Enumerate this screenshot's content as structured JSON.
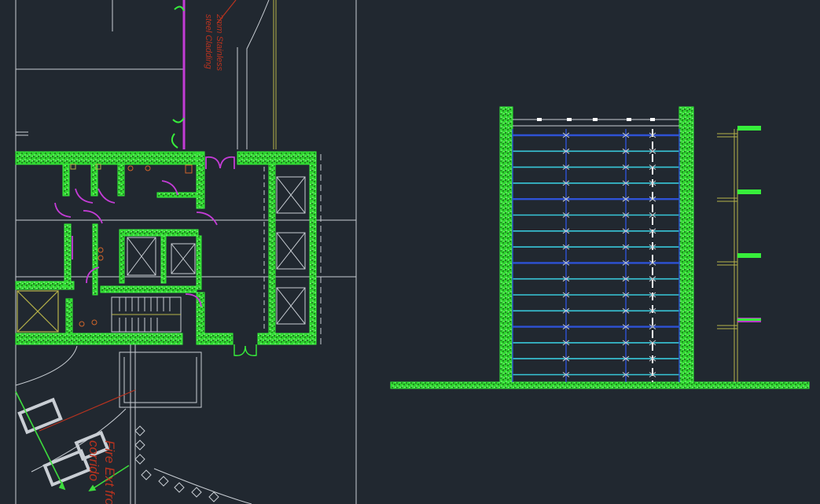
{
  "viewport": {
    "background": "#212830"
  },
  "colors": {
    "line": "#c9ced4",
    "wall_hatch": "#37ee3b",
    "wall_dark": "#1e8a22",
    "door": "#c43cd6",
    "annotation": "#b8331f",
    "glass": "#38c7d9",
    "mullion": "#2e52d6",
    "pointer": "#3ddc3d",
    "olive": "#b8b34a",
    "white": "#ffffff"
  },
  "annotations": {
    "cladding_note_line1": "2mm Stainless",
    "cladding_note_line2": "steel Cladding",
    "fire_exit_line1": "Fire Ext fro",
    "fire_exit_line2": "corrido"
  },
  "icons": {
    "elevator_symbol": "cross-box",
    "stair_symbol": "stair-treads",
    "toilet_symbol": "wc-fixture"
  }
}
